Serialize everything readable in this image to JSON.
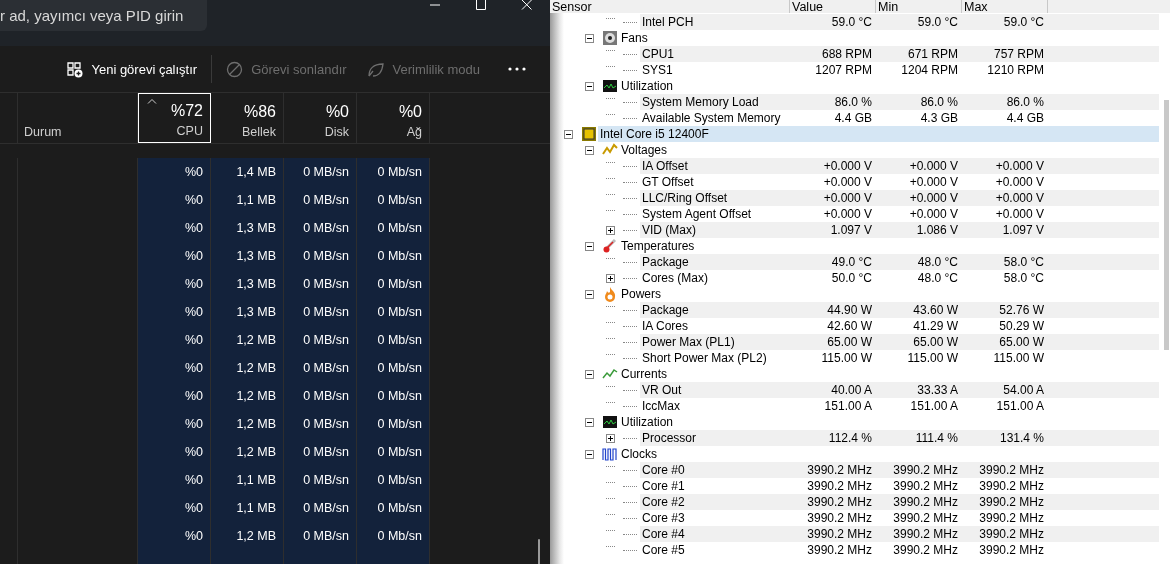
{
  "task_manager": {
    "search": {
      "placeholder": "r ad, yayımcı veya PID girin"
    },
    "toolbar": [
      {
        "label": "Yeni görevi çalıştır",
        "kind": "new",
        "disabled": false
      },
      {
        "label": "Görevi sonlandır",
        "kind": "end",
        "disabled": true
      },
      {
        "label": "Verimlilik modu",
        "kind": "eco",
        "disabled": true
      }
    ],
    "columns": [
      {
        "label": "Durum"
      },
      {
        "value": "%72",
        "label": "CPU",
        "selected": true
      },
      {
        "value": "%86",
        "label": "Bellek",
        "selected": false
      },
      {
        "value": "%0",
        "label": "Disk",
        "selected": false
      },
      {
        "value": "%0",
        "label": "Ağ",
        "selected": false
      }
    ],
    "rows": [
      {
        "cpu": "%0",
        "memory": "1,4 MB",
        "disk": "0 MB/sn",
        "network": "0 Mb/sn"
      },
      {
        "cpu": "%0",
        "memory": "1,1 MB",
        "disk": "0 MB/sn",
        "network": "0 Mb/sn"
      },
      {
        "cpu": "%0",
        "memory": "1,3 MB",
        "disk": "0 MB/sn",
        "network": "0 Mb/sn"
      },
      {
        "cpu": "%0",
        "memory": "1,3 MB",
        "disk": "0 MB/sn",
        "network": "0 Mb/sn"
      },
      {
        "cpu": "%0",
        "memory": "1,3 MB",
        "disk": "0 MB/sn",
        "network": "0 Mb/sn"
      },
      {
        "cpu": "%0",
        "memory": "1,3 MB",
        "disk": "0 MB/sn",
        "network": "0 Mb/sn"
      },
      {
        "cpu": "%0",
        "memory": "1,2 MB",
        "disk": "0 MB/sn",
        "network": "0 Mb/sn"
      },
      {
        "cpu": "%0",
        "memory": "1,2 MB",
        "disk": "0 MB/sn",
        "network": "0 Mb/sn"
      },
      {
        "cpu": "%0",
        "memory": "1,2 MB",
        "disk": "0 MB/sn",
        "network": "0 Mb/sn"
      },
      {
        "cpu": "%0",
        "memory": "1,2 MB",
        "disk": "0 MB/sn",
        "network": "0 Mb/sn"
      },
      {
        "cpu": "%0",
        "memory": "1,2 MB",
        "disk": "0 MB/sn",
        "network": "0 Mb/sn"
      },
      {
        "cpu": "%0",
        "memory": "1,1 MB",
        "disk": "0 MB/sn",
        "network": "0 Mb/sn"
      },
      {
        "cpu": "%0",
        "memory": "1,1 MB",
        "disk": "0 MB/sn",
        "network": "0 Mb/sn"
      },
      {
        "cpu": "%0",
        "memory": "1,2 MB",
        "disk": "0 MB/sn",
        "network": "0 Mb/sn"
      }
    ]
  },
  "sensors": {
    "columns": [
      "Sensor",
      "Value",
      "Min",
      "Max"
    ],
    "tree": [
      {
        "children": [
          {
            "children": [
              {
                "label": "Intel PCH",
                "value": "59.0 °C",
                "min": "59.0 °C",
                "max": "59.0 °C"
              }
            ]
          },
          {
            "label": "Fans",
            "kind": "fan",
            "expanded": true,
            "children": [
              {
                "label": "CPU1",
                "value": "688 RPM",
                "min": "671 RPM",
                "max": "757 RPM"
              },
              {
                "label": "SYS1",
                "value": "1207 RPM",
                "min": "1204 RPM",
                "max": "1210 RPM"
              }
            ]
          },
          {
            "label": "Utilization",
            "kind": "meter",
            "expanded": true,
            "children": [
              {
                "label": "System Memory Load",
                "value": "86.0 %",
                "min": "86.0 %",
                "max": "86.0 %"
              },
              {
                "label": "Available System Memory",
                "value": "4.4 GB",
                "min": "4.3 GB",
                "max": "4.4 GB"
              }
            ]
          }
        ]
      },
      {
        "label": "Intel Core i5 12400F",
        "kind": "chip",
        "expanded": true,
        "selected": true,
        "children": [
          {
            "label": "Voltages",
            "kind": "voltage",
            "expanded": true,
            "children": [
              {
                "label": "IA Offset",
                "value": "+0.000 V",
                "min": "+0.000 V",
                "max": "+0.000 V"
              },
              {
                "label": "GT Offset",
                "value": "+0.000 V",
                "min": "+0.000 V",
                "max": "+0.000 V"
              },
              {
                "label": "LLC/Ring Offset",
                "value": "+0.000 V",
                "min": "+0.000 V",
                "max": "+0.000 V"
              },
              {
                "label": "System Agent Offset",
                "value": "+0.000 V",
                "min": "+0.000 V",
                "max": "+0.000 V"
              },
              {
                "label": "VID (Max)",
                "value": "1.097 V",
                "min": "1.086 V",
                "max": "1.097 V",
                "expanded": false
              }
            ]
          },
          {
            "label": "Temperatures",
            "kind": "thermometer",
            "expanded": true,
            "children": [
              {
                "label": "Package",
                "value": "49.0 °C",
                "min": "48.0 °C",
                "max": "58.0 °C"
              },
              {
                "label": "Cores (Max)",
                "value": "50.0 °C",
                "min": "48.0 °C",
                "max": "58.0 °C",
                "expanded": false
              }
            ]
          },
          {
            "label": "Powers",
            "kind": "flame",
            "expanded": true,
            "children": [
              {
                "label": "Package",
                "value": "44.90 W",
                "min": "43.60 W",
                "max": "52.76 W"
              },
              {
                "label": "IA Cores",
                "value": "42.60 W",
                "min": "41.29 W",
                "max": "50.29 W"
              },
              {
                "label": "Power Max (PL1)",
                "value": "65.00 W",
                "min": "65.00 W",
                "max": "65.00 W"
              },
              {
                "label": "Short Power Max (PL2)",
                "value": "115.00 W",
                "min": "115.00 W",
                "max": "115.00 W"
              }
            ]
          },
          {
            "label": "Currents",
            "kind": "current",
            "expanded": true,
            "children": [
              {
                "label": "VR Out",
                "value": "40.00 A",
                "min": "33.33 A",
                "max": "54.00 A"
              },
              {
                "label": "IccMax",
                "value": "151.00 A",
                "min": "151.00 A",
                "max": "151.00 A"
              }
            ]
          },
          {
            "label": "Utilization",
            "kind": "meter",
            "expanded": true,
            "children": [
              {
                "label": "Processor",
                "value": "112.4 %",
                "min": "111.4 %",
                "max": "131.4 %",
                "expanded": false
              }
            ]
          },
          {
            "label": "Clocks",
            "kind": "clock",
            "expanded": true,
            "children": [
              {
                "label": "Core #0",
                "value": "3990.2 MHz",
                "min": "3990.2 MHz",
                "max": "3990.2 MHz"
              },
              {
                "label": "Core #1",
                "value": "3990.2 MHz",
                "min": "3990.2 MHz",
                "max": "3990.2 MHz"
              },
              {
                "label": "Core #2",
                "value": "3990.2 MHz",
                "min": "3990.2 MHz",
                "max": "3990.2 MHz"
              },
              {
                "label": "Core #3",
                "value": "3990.2 MHz",
                "min": "3990.2 MHz",
                "max": "3990.2 MHz"
              },
              {
                "label": "Core #4",
                "value": "3990.2 MHz",
                "min": "3990.2 MHz",
                "max": "3990.2 MHz"
              },
              {
                "label": "Core #5",
                "value": "3990.2 MHz",
                "min": "3990.2 MHz",
                "max": "3990.2 MHz"
              }
            ]
          }
        ]
      }
    ]
  }
}
